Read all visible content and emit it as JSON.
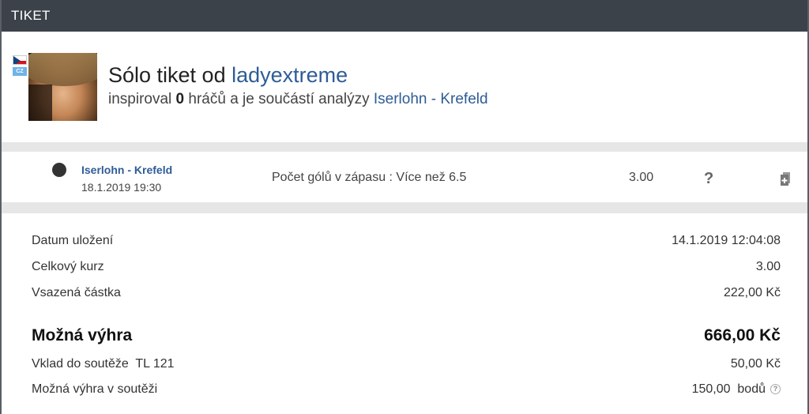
{
  "window": {
    "title": "TIKET"
  },
  "profile": {
    "flag_label": "CZ",
    "headline_prefix": "Sólo tiket od ",
    "username": "ladyextreme",
    "sub_prefix": "inspiroval ",
    "inspired_count": "0",
    "sub_middle": " hráčů a je součástí analýzy ",
    "analysis_link": "Iserlohn - Krefeld"
  },
  "match": {
    "name": "Iserlohn - Krefeld",
    "datetime": "18.1.2019 19:30",
    "bet": "Počet gólů v zápasu : Více než 6.5",
    "odd": "3.00",
    "result_symbol": "?"
  },
  "details": {
    "saved_label": "Datum uložení",
    "saved_value": "14.1.2019 12:04:08",
    "total_odds_label": "Celkový kurz",
    "total_odds_value": "3.00",
    "stake_label": "Vsazená částka",
    "stake_value": "222,00 Kč",
    "possible_win_label": "Možná výhra",
    "possible_win_value": "666,00 Kč",
    "contest_stake_label": "Vklad do soutěže  TL 121",
    "contest_stake_value": "50,00 Kč",
    "contest_win_label": "Možná výhra v soutěži",
    "contest_win_value": "150,00  bodů",
    "contest_help_symbol": "?"
  },
  "icons": {
    "flag": "czech-flag-icon",
    "status": "status-dot-icon",
    "add": "add-document-icon",
    "help": "help-icon"
  },
  "colors": {
    "titlebar": "#3c4249",
    "link": "#2e5c96",
    "band": "#e6e6e6"
  }
}
